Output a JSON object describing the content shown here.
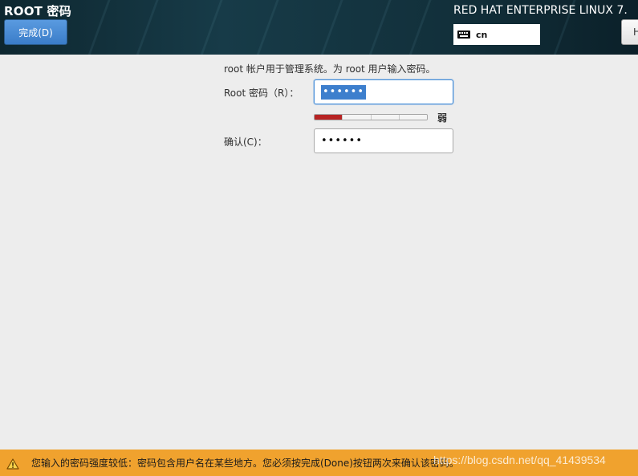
{
  "header": {
    "title": "ROOT 密码",
    "done_label": "完成(D)",
    "product": "RED HAT ENTERPRISE LINUX 7.",
    "keyboard_layout": "cn",
    "help_label": "H"
  },
  "form": {
    "intro": "root 帐户用于管理系统。为 root 用户输入密码。",
    "root_label": "Root 密码（R）：",
    "root_value": "••••••",
    "strength_label": "弱",
    "strength_level": 0.25,
    "confirm_label": "确认(C)：",
    "confirm_value": "••••••"
  },
  "warning": {
    "text": "您输入的密码强度较低：密码包含用户名在某些地方。您必须按完成(Done)按钮两次来确认该密码。"
  },
  "watermark": "https://blog.csdn.net/qq_41439534",
  "colors": {
    "accent": "#3d7fcd",
    "strength_bar": "#b72323",
    "warning_bar": "#f0a22e"
  }
}
